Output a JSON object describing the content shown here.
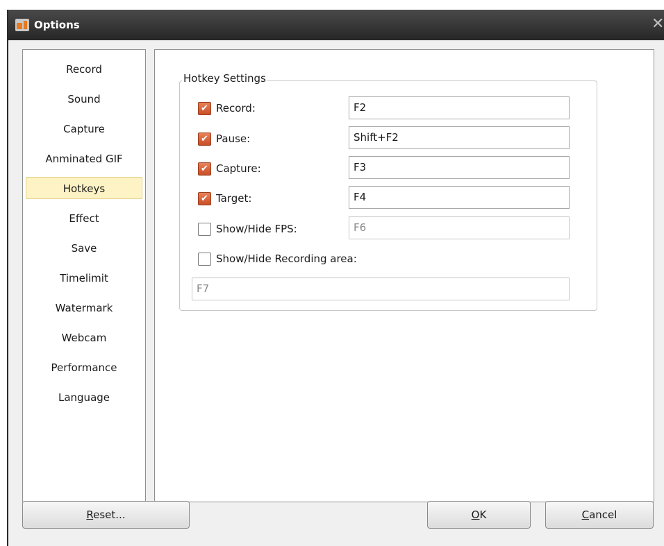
{
  "window": {
    "title": "Options",
    "close_glyph": "✕",
    "icon": "app-icon"
  },
  "sidebar": {
    "items": [
      {
        "label": "Record"
      },
      {
        "label": "Sound"
      },
      {
        "label": "Capture"
      },
      {
        "label": "Anminated GIF"
      },
      {
        "label": "Hotkeys",
        "selected": true
      },
      {
        "label": "Effect"
      },
      {
        "label": "Save"
      },
      {
        "label": "Timelimit"
      },
      {
        "label": "Watermark"
      },
      {
        "label": "Webcam"
      },
      {
        "label": "Performance"
      },
      {
        "label": "Language"
      }
    ]
  },
  "hotkeys": {
    "group_title": "Hotkey Settings",
    "rows": [
      {
        "label": "Record:",
        "checked": true,
        "value": "F2"
      },
      {
        "label": "Pause:",
        "checked": true,
        "value": "Shift+F2"
      },
      {
        "label": "Capture:",
        "checked": true,
        "value": "F3"
      },
      {
        "label": "Target:",
        "checked": true,
        "value": "F4"
      },
      {
        "label": "Show/Hide FPS:",
        "checked": false,
        "value": "F6"
      },
      {
        "label": "Show/Hide Recording area:",
        "checked": false,
        "value": "F7"
      }
    ],
    "check_glyph": "✔"
  },
  "buttons": {
    "reset": {
      "mnemonic": "R",
      "rest": "eset..."
    },
    "ok": {
      "mnemonic": "O",
      "rest": "K"
    },
    "cancel": {
      "mnemonic": "C",
      "rest": "ancel"
    }
  },
  "colors": {
    "checkbox_checked": "#d35f34",
    "selected_item_bg": "#fdf3c4",
    "titlebar": "#333333"
  }
}
